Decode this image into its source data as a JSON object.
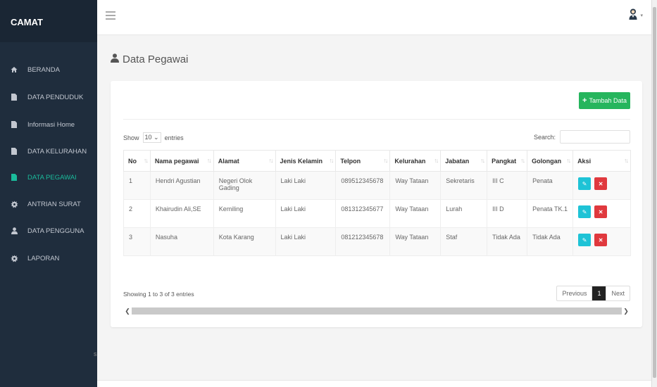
{
  "brand": "CAMAT",
  "sidebar": {
    "items": [
      {
        "label": "BERANDA",
        "icon": "home-icon"
      },
      {
        "label": "DATA PENDUDUK",
        "icon": "file-icon"
      },
      {
        "label": "Informasi Home",
        "icon": "file-icon"
      },
      {
        "label": "DATA KELURAHAN",
        "icon": "file-icon"
      },
      {
        "label": "DATA PEGAWAI",
        "icon": "file-icon"
      },
      {
        "label": "ANTRIAN SURAT",
        "icon": "gear-icon"
      },
      {
        "label": "DATA PENGGUNA",
        "icon": "user-icon"
      },
      {
        "label": "LAPORAN",
        "icon": "gear-icon"
      }
    ],
    "stray_text": "s"
  },
  "page": {
    "title": "Data Pegawai",
    "add_button": "Tambah Data"
  },
  "table_controls": {
    "show_label": "Show",
    "entries_value": "10",
    "entries_label": "entries",
    "search_label": "Search:"
  },
  "table": {
    "columns": [
      "No",
      "Nama pegawai",
      "Alamat",
      "Jenis Kelamin",
      "Telpon",
      "Kelurahan",
      "Jabatan",
      "Pangkat",
      "Golongan",
      "Aksi"
    ],
    "rows": [
      [
        "1",
        "Hendri Agustian",
        "Negeri Olok Gading",
        "Laki Laki",
        "089512345678",
        "Way Tataan",
        "Sekretaris",
        "III C",
        "Penata"
      ],
      [
        "2",
        "Khairudin Ali,SE",
        "Kemiling",
        "Laki Laki",
        "081312345677",
        "Way Tataan",
        "Lurah",
        "III D",
        "Penata TK.1"
      ],
      [
        "3",
        "Nasuha",
        "Kota Karang",
        "Laki Laki",
        "081212345678",
        "Way Tataan",
        "Staf",
        "Tidak Ada",
        "Tidak Ada"
      ]
    ]
  },
  "pagination": {
    "info": "Showing 1 to 3 of 3 entries",
    "previous": "Previous",
    "current": "1",
    "next": "Next"
  },
  "colors": {
    "sidebar_bg": "#1f2d3d",
    "active": "#1abc9c",
    "add_button": "#26b55d",
    "edit_button": "#1ec3d6",
    "delete_button": "#e0393e"
  }
}
